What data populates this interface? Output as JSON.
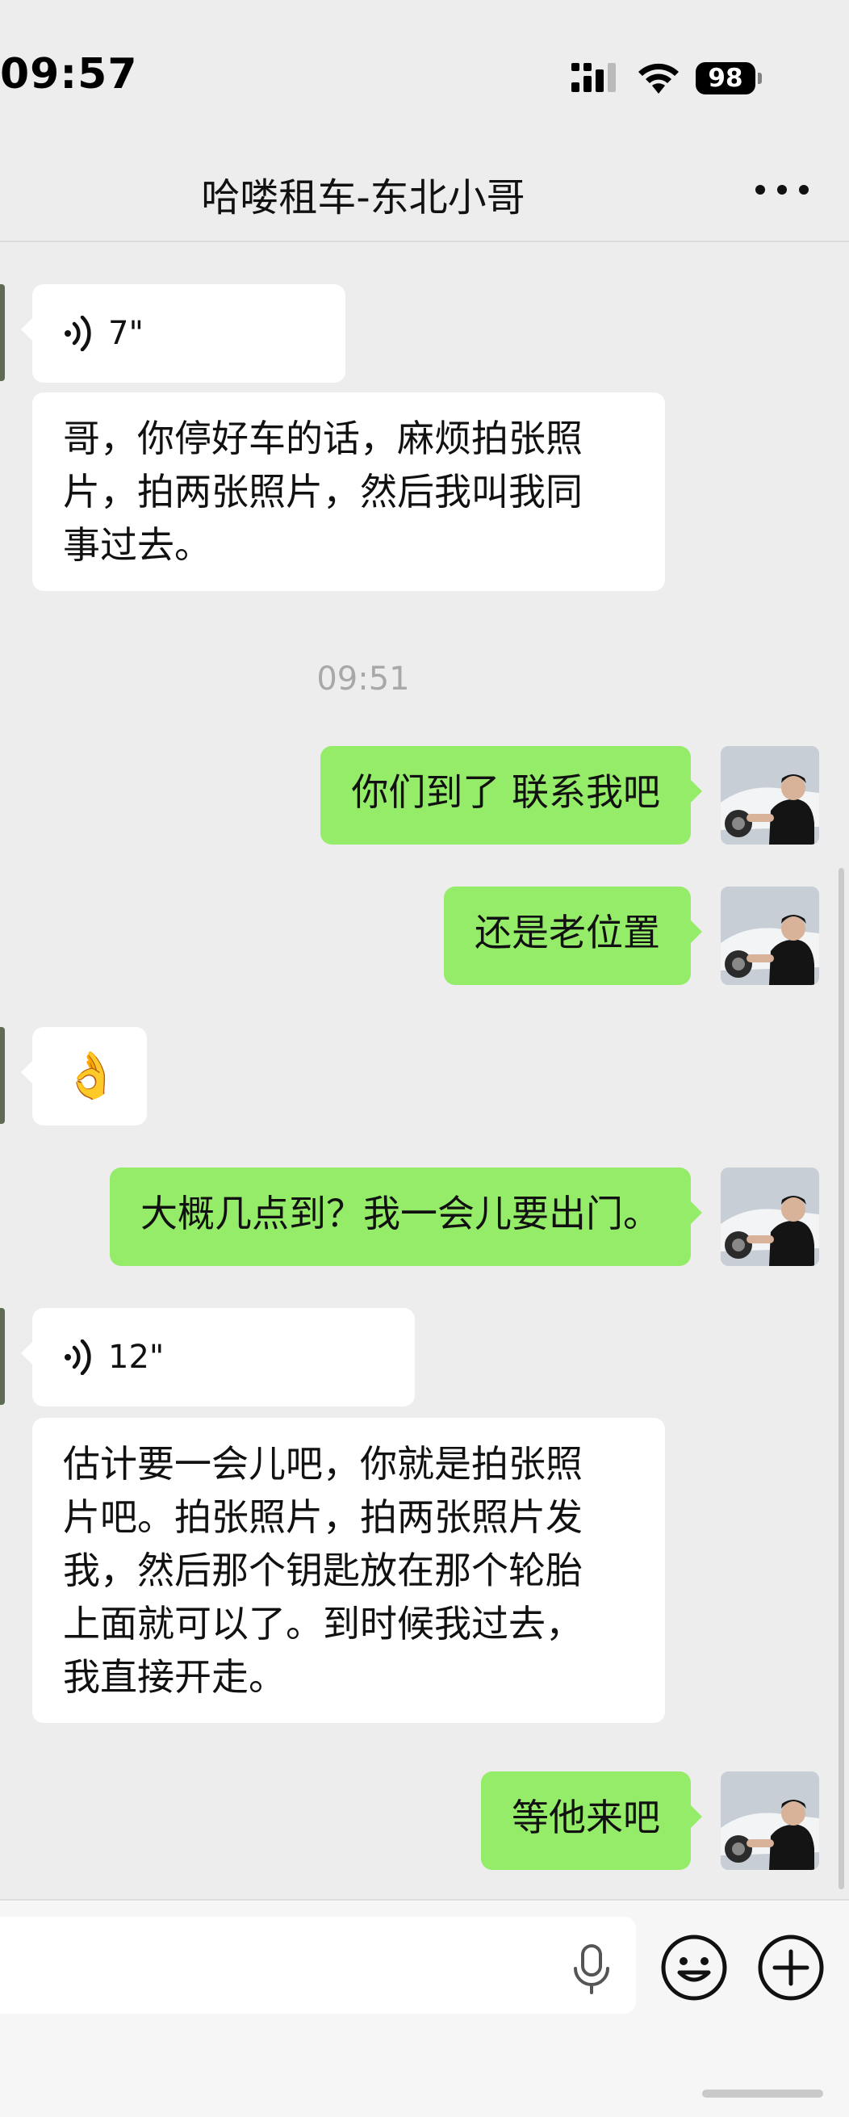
{
  "status_bar": {
    "time": "09:57",
    "battery": "98"
  },
  "header": {
    "title": "哈喽租车-东北小哥",
    "more_icon": "more-dots-icon"
  },
  "messages": [
    {
      "side": "in",
      "type": "voice",
      "duration": "7\""
    },
    {
      "side": "in",
      "type": "text",
      "lines": [
        "哥，你停好车的话，麻烦拍张照",
        "片，拍两张照片，然后我叫我同",
        "事过去。"
      ]
    },
    {
      "type": "time",
      "text": "09:51"
    },
    {
      "side": "out",
      "type": "text",
      "text": "你们到了 联系我吧"
    },
    {
      "side": "out",
      "type": "text",
      "text": "还是老位置"
    },
    {
      "side": "in",
      "type": "emoji",
      "text": "👌"
    },
    {
      "side": "out",
      "type": "text",
      "text": "大概几点到？我一会儿要出门。"
    },
    {
      "side": "in",
      "type": "voice",
      "duration": "12\""
    },
    {
      "side": "in",
      "type": "text",
      "lines": [
        "估计要一会儿吧，你就是拍张照",
        "片吧。拍张照片，拍两张照片发",
        "我，然后那个钥匙放在那个轮胎",
        "上面就可以了。到时候我过去，",
        "我直接开走。"
      ]
    },
    {
      "side": "out",
      "type": "text",
      "text": "等他来吧"
    }
  ],
  "input_bar": {
    "voice_icon": "microphone-icon",
    "emoji_icon": "smiley-icon",
    "more_icon": "plus-circle-icon"
  },
  "colors": {
    "outgoing_bubble": "#95ec69",
    "incoming_bubble": "#ffffff",
    "background": "#ededed"
  }
}
